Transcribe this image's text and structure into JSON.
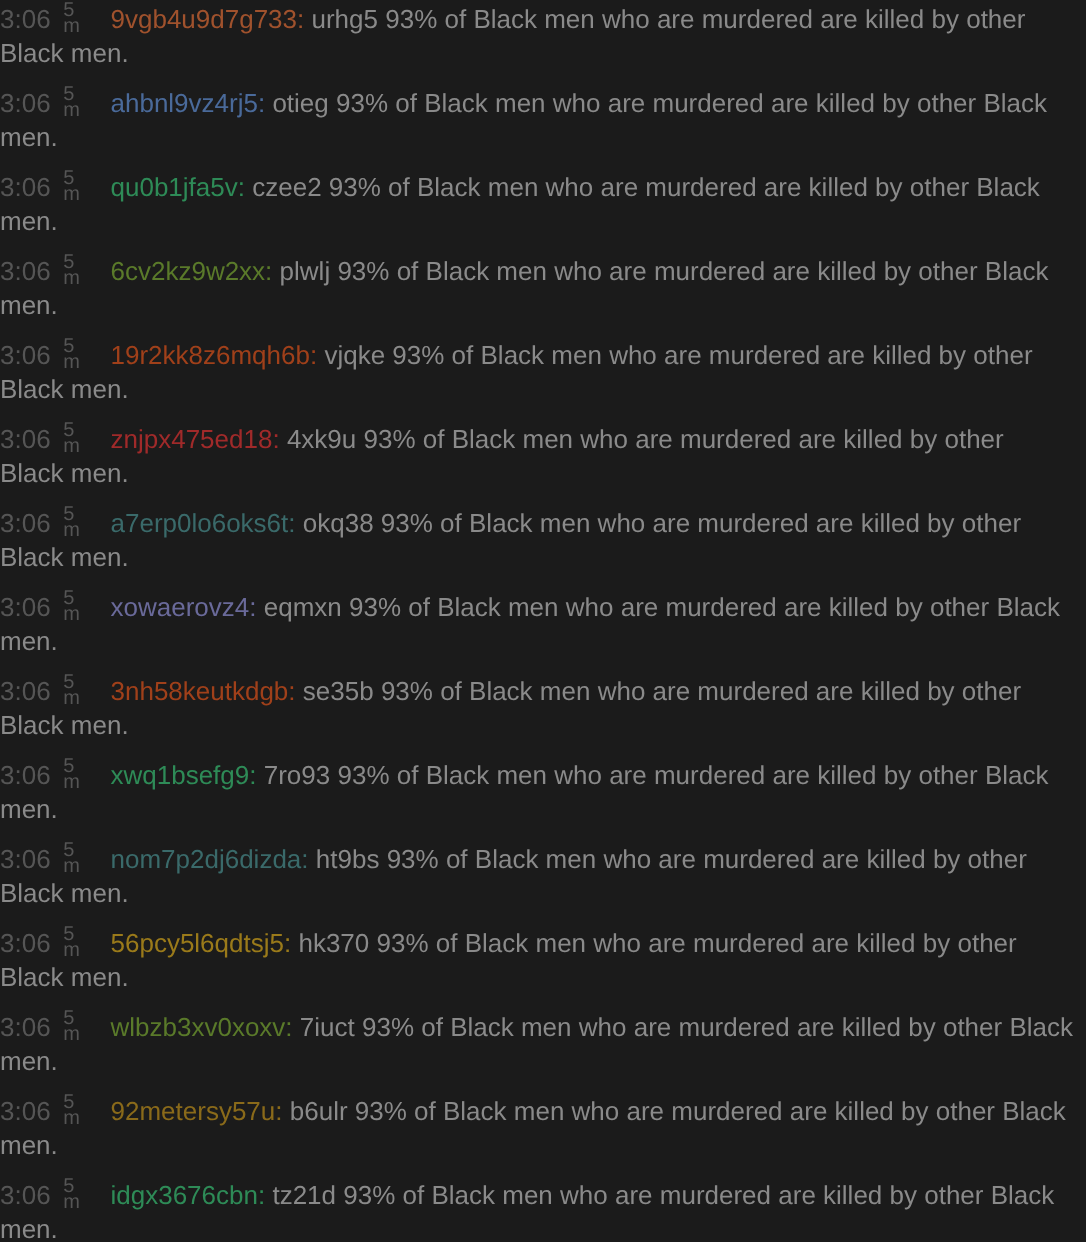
{
  "messages": [
    {
      "time": "3:06",
      "age_value": "5",
      "age_unit": "m",
      "user": "9vgb4u9d7g733:",
      "color": "#a0522d",
      "text": "urhg5 93% of Black men who are murdered are killed by other Black men."
    },
    {
      "time": "3:06",
      "age_value": "5",
      "age_unit": "m",
      "user": "ahbnl9vz4rj5:",
      "color": "#4a6a9a",
      "text": "otieg 93% of Black men who are murdered are killed by other Black men."
    },
    {
      "time": "3:06",
      "age_value": "5",
      "age_unit": "m",
      "user": "qu0b1jfa5v:",
      "color": "#2e8b57",
      "text": "czee2 93% of Black men who are murdered are killed by other Black men."
    },
    {
      "time": "3:06",
      "age_value": "5",
      "age_unit": "m",
      "user": "6cv2kz9w2xx:",
      "color": "#5a7a2a",
      "text": "plwlj 93% of Black men who are murdered are killed by other Black men."
    },
    {
      "time": "3:06",
      "age_value": "5",
      "age_unit": "m",
      "user": "19r2kk8z6mqh6b:",
      "color": "#a0401a",
      "text": "vjqke 93% of Black men who are murdered are killed by other Black men."
    },
    {
      "time": "3:06",
      "age_value": "5",
      "age_unit": "m",
      "user": "znjpx475ed18:",
      "color": "#a02a2a",
      "text": "4xk9u 93% of Black men who are murdered are killed by other Black men."
    },
    {
      "time": "3:06",
      "age_value": "5",
      "age_unit": "m",
      "user": "a7erp0lo6oks6t:",
      "color": "#3a6a6a",
      "text": "okq38 93% of Black men who are murdered are killed by other Black men."
    },
    {
      "time": "3:06",
      "age_value": "5",
      "age_unit": "m",
      "user": "xowaerovz4:",
      "color": "#6a6a9a",
      "text": "eqmxn 93% of Black men who are murdered are killed by other Black men."
    },
    {
      "time": "3:06",
      "age_value": "5",
      "age_unit": "m",
      "user": "3nh58keutkdgb:",
      "color": "#a0401a",
      "text": "se35b 93% of Black men who are murdered are killed by other Black men."
    },
    {
      "time": "3:06",
      "age_value": "5",
      "age_unit": "m",
      "user": "xwq1bsefg9:",
      "color": "#2e8b57",
      "text": "7ro93 93% of Black men who are murdered are killed by other Black men."
    },
    {
      "time": "3:06",
      "age_value": "5",
      "age_unit": "m",
      "user": "nom7p2dj6dizda:",
      "color": "#3a6a6a",
      "text": "ht9bs 93% of Black men who are murdered are killed by other Black men."
    },
    {
      "time": "3:06",
      "age_value": "5",
      "age_unit": "m",
      "user": "56pcy5l6qdtsj5:",
      "color": "#9a7a1a",
      "text": "hk370 93% of Black men who are murdered are killed by other Black men."
    },
    {
      "time": "3:06",
      "age_value": "5",
      "age_unit": "m",
      "user": "wlbzb3xv0xoxv:",
      "color": "#5a7a2a",
      "text": "7iuct 93% of Black men who are murdered are killed by other Black men."
    },
    {
      "time": "3:06",
      "age_value": "5",
      "age_unit": "m",
      "user": "92metersy57u:",
      "color": "#8a6a1a",
      "text": "b6ulr 93% of Black men who are murdered are killed by other Black men."
    },
    {
      "time": "3:06",
      "age_value": "5",
      "age_unit": "m",
      "user": "idgx3676cbn:",
      "color": "#2e8b57",
      "text": "tz21d 93% of Black men who are murdered are killed by other Black men."
    }
  ]
}
